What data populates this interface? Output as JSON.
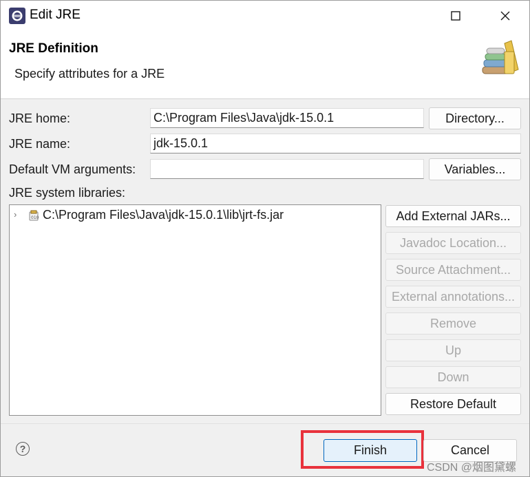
{
  "window": {
    "title": "Edit JRE"
  },
  "header": {
    "title": "JRE Definition",
    "description": "Specify attributes for a JRE",
    "icon": "libraries-books-icon"
  },
  "form": {
    "jre_home": {
      "label": "JRE home:",
      "value": "C:\\Program Files\\Java\\jdk-15.0.1",
      "button": "Directory..."
    },
    "jre_name": {
      "label": "JRE name:",
      "value": "jdk-15.0.1"
    },
    "vm_args": {
      "label": "Default VM arguments:",
      "value": "",
      "button": "Variables..."
    },
    "libraries_label": "JRE system libraries:",
    "libraries": [
      {
        "path": "C:\\Program Files\\Java\\jdk-15.0.1\\lib\\jrt-fs.jar",
        "icon": "jar-icon"
      }
    ]
  },
  "side_buttons": [
    {
      "label": "Add External JARs...",
      "enabled": true
    },
    {
      "label": "Javadoc Location...",
      "enabled": false
    },
    {
      "label": "Source Attachment...",
      "enabled": false
    },
    {
      "label": "External annotations...",
      "enabled": false
    },
    {
      "label": "Remove",
      "enabled": false
    },
    {
      "label": "Up",
      "enabled": false
    },
    {
      "label": "Down",
      "enabled": false
    },
    {
      "label": "Restore Default",
      "enabled": true
    }
  ],
  "footer": {
    "help_icon": "help-icon",
    "finish": "Finish",
    "cancel": "Cancel"
  },
  "watermark": "CSDN @烟图黛螺",
  "colors": {
    "highlight": "#e8323c",
    "default_button_border": "#0067c0"
  }
}
